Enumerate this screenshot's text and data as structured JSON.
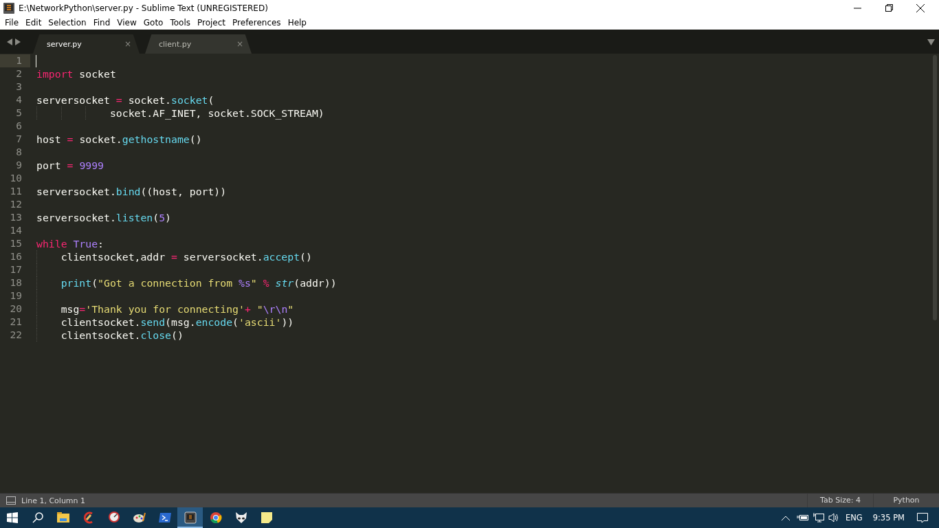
{
  "window": {
    "title": "E:\\NetworkPython\\server.py - Sublime Text (UNREGISTERED)"
  },
  "menu": [
    "File",
    "Edit",
    "Selection",
    "Find",
    "View",
    "Goto",
    "Tools",
    "Project",
    "Preferences",
    "Help"
  ],
  "tabs": [
    {
      "label": "server.py",
      "selected": true,
      "close": "×"
    },
    {
      "label": "client.py",
      "selected": false,
      "close": "×"
    }
  ],
  "editor": {
    "lines": [
      {
        "number": "1",
        "current": true
      },
      {
        "number": "2",
        "current": false,
        "tokens": [
          {
            "kind": "keyword",
            "text": "import"
          },
          {
            "kind": "plain",
            "text": " socket"
          }
        ]
      },
      {
        "number": "3",
        "current": false
      },
      {
        "number": "4",
        "current": false,
        "tokens": [
          {
            "kind": "plain",
            "text": "serversocket "
          },
          {
            "kind": "operator",
            "text": "="
          },
          {
            "kind": "plain",
            "text": " socket."
          },
          {
            "kind": "function",
            "text": "socket"
          },
          {
            "kind": "plain",
            "text": "("
          }
        ]
      },
      {
        "number": "5",
        "current": false,
        "tokens": [
          {
            "kind": "plain",
            "text": "            socket.AF_INET, socket.SOCK_STREAM)"
          }
        ]
      },
      {
        "number": "6",
        "current": false
      },
      {
        "number": "7",
        "current": false,
        "tokens": [
          {
            "kind": "plain",
            "text": "host "
          },
          {
            "kind": "operator",
            "text": "="
          },
          {
            "kind": "plain",
            "text": " socket."
          },
          {
            "kind": "function",
            "text": "gethostname"
          },
          {
            "kind": "plain",
            "text": "()"
          }
        ]
      },
      {
        "number": "8",
        "current": false
      },
      {
        "number": "9",
        "current": false,
        "tokens": [
          {
            "kind": "plain",
            "text": "port "
          },
          {
            "kind": "operator",
            "text": "="
          },
          {
            "kind": "number",
            "text": " 9999"
          }
        ]
      },
      {
        "number": "10",
        "current": false
      },
      {
        "number": "11",
        "current": false,
        "tokens": [
          {
            "kind": "plain",
            "text": "serversocket."
          },
          {
            "kind": "function",
            "text": "bind"
          },
          {
            "kind": "plain",
            "text": "((host, port))"
          }
        ]
      },
      {
        "number": "12",
        "current": false
      },
      {
        "number": "13",
        "current": false,
        "tokens": [
          {
            "kind": "plain",
            "text": "serversocket."
          },
          {
            "kind": "function",
            "text": "listen"
          },
          {
            "kind": "plain",
            "text": "("
          },
          {
            "kind": "number",
            "text": "5"
          },
          {
            "kind": "plain",
            "text": ")"
          }
        ]
      },
      {
        "number": "14",
        "current": false
      },
      {
        "number": "15",
        "current": false,
        "tokens": [
          {
            "kind": "keyword",
            "text": "while"
          },
          {
            "kind": "number",
            "text": " True"
          },
          {
            "kind": "plain",
            "text": ":"
          }
        ]
      },
      {
        "number": "16",
        "current": false,
        "tokens": [
          {
            "kind": "plain",
            "text": "    clientsocket,addr "
          },
          {
            "kind": "operator",
            "text": "="
          },
          {
            "kind": "plain",
            "text": " serversocket."
          },
          {
            "kind": "function",
            "text": "accept"
          },
          {
            "kind": "plain",
            "text": "()"
          }
        ]
      },
      {
        "number": "17",
        "current": false
      },
      {
        "number": "18",
        "current": false,
        "tokens": [
          {
            "kind": "function",
            "text": "    print"
          },
          {
            "kind": "plain",
            "text": "("
          },
          {
            "kind": "string",
            "text": "\"Got a connection from "
          },
          {
            "kind": "number",
            "text": "%s"
          },
          {
            "kind": "string",
            "text": "\""
          },
          {
            "kind": "operator",
            "text": " % "
          },
          {
            "kind": "builtin",
            "text": "str"
          },
          {
            "kind": "plain",
            "text": "(addr))"
          }
        ]
      },
      {
        "number": "19",
        "current": false
      },
      {
        "number": "20",
        "current": false,
        "tokens": [
          {
            "kind": "plain",
            "text": "    msg"
          },
          {
            "kind": "operator",
            "text": "="
          },
          {
            "kind": "string",
            "text": "'Thank you for connecting'"
          },
          {
            "kind": "operator",
            "text": "+"
          },
          {
            "kind": "string",
            "text": " \""
          },
          {
            "kind": "number",
            "text": "\\r\\n"
          },
          {
            "kind": "string",
            "text": "\""
          }
        ]
      },
      {
        "number": "21",
        "current": false,
        "tokens": [
          {
            "kind": "plain",
            "text": "    clientsocket."
          },
          {
            "kind": "function",
            "text": "send"
          },
          {
            "kind": "plain",
            "text": "(msg."
          },
          {
            "kind": "function",
            "text": "encode"
          },
          {
            "kind": "plain",
            "text": "("
          },
          {
            "kind": "string",
            "text": "'ascii'"
          },
          {
            "kind": "plain",
            "text": "))"
          }
        ]
      },
      {
        "number": "22",
        "current": false,
        "tokens": [
          {
            "kind": "plain",
            "text": "    clientsocket."
          },
          {
            "kind": "function",
            "text": "close"
          },
          {
            "kind": "plain",
            "text": "()"
          }
        ]
      }
    ]
  },
  "status_bar": {
    "position": "Line 1, Column 1",
    "tab_size": "Tab Size: 4",
    "syntax": "Python"
  },
  "taskbar": {
    "apps": [
      {
        "kind": "folder",
        "selected": false
      },
      {
        "kind": "cleaner",
        "selected": false
      },
      {
        "kind": "gauge",
        "selected": false
      },
      {
        "kind": "paint",
        "selected": false
      },
      {
        "kind": "terminal",
        "selected": false
      },
      {
        "kind": "sublime",
        "selected": true
      },
      {
        "kind": "browser",
        "selected": false
      },
      {
        "kind": "mask",
        "selected": false
      },
      {
        "kind": "note",
        "selected": false
      }
    ],
    "language": "ENG",
    "time": "9:35 PM"
  }
}
